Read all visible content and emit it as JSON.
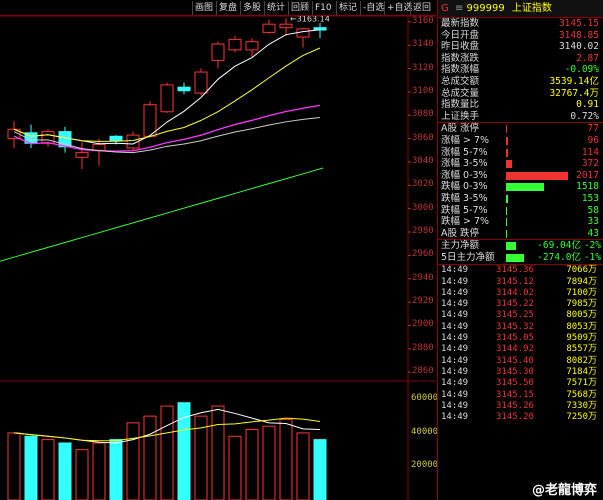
{
  "toolbar": {
    "items": [
      "画图",
      "复盘",
      "多股",
      "统计",
      "回顾",
      "F10",
      "标记",
      "-自选",
      "+自选",
      "返回"
    ]
  },
  "chart": {
    "price_ticks": [
      "3160",
      "3140",
      "3120",
      "3100",
      "3080",
      "3060",
      "3040",
      "3020",
      "3000",
      "2980",
      "2960",
      "2940",
      "2920",
      "2900",
      "2880",
      "2860"
    ],
    "volume_ticks": [
      "60000",
      "40000",
      "20000"
    ],
    "high_label": "3163.14",
    "colors": {
      "up": "#ff3333",
      "down": "#33ffff",
      "ma5": "#ffffff",
      "ma10": "#ffff33",
      "ma20": "#ff33ff",
      "ma30": "#cccccc",
      "ma60": "#33ff33"
    }
  },
  "chart_data": {
    "type": "candlestick",
    "ohlc": [
      {
        "o": 3060,
        "h": 3075,
        "l": 3052,
        "c": 3068
      },
      {
        "o": 3065,
        "h": 3072,
        "l": 3052,
        "c": 3056
      },
      {
        "o": 3056,
        "h": 3068,
        "l": 3053,
        "c": 3066
      },
      {
        "o": 3066,
        "h": 3070,
        "l": 3048,
        "c": 3053
      },
      {
        "o": 3044,
        "h": 3057,
        "l": 3034,
        "c": 3048
      },
      {
        "o": 3050,
        "h": 3060,
        "l": 3037,
        "c": 3055
      },
      {
        "o": 3062,
        "h": 3063,
        "l": 3055,
        "c": 3058
      },
      {
        "o": 3052,
        "h": 3066,
        "l": 3050,
        "c": 3063
      },
      {
        "o": 3062,
        "h": 3092,
        "l": 3061,
        "c": 3089
      },
      {
        "o": 3083,
        "h": 3108,
        "l": 3082,
        "c": 3106
      },
      {
        "o": 3104,
        "h": 3108,
        "l": 3098,
        "c": 3101
      },
      {
        "o": 3099,
        "h": 3120,
        "l": 3097,
        "c": 3117
      },
      {
        "o": 3127,
        "h": 3143,
        "l": 3120,
        "c": 3141
      },
      {
        "o": 3136,
        "h": 3148,
        "l": 3134,
        "c": 3145
      },
      {
        "o": 3136,
        "h": 3146,
        "l": 3130,
        "c": 3143
      },
      {
        "o": 3151,
        "h": 3162,
        "l": 3150,
        "c": 3158
      },
      {
        "o": 3155,
        "h": 3163,
        "l": 3148,
        "c": 3158
      },
      {
        "o": 3147,
        "h": 3155,
        "l": 3138,
        "c": 3154
      },
      {
        "o": 3155,
        "h": 3159,
        "l": 3146,
        "c": 3153
      }
    ],
    "volume": [
      40000,
      38000,
      36000,
      34000,
      30000,
      34000,
      36000,
      46000,
      50000,
      56000,
      58000,
      50000,
      56000,
      38000,
      42000,
      44000,
      48000,
      40000,
      36000
    ]
  },
  "panel": {
    "code": "999999",
    "name": "上证指数",
    "quote": [
      {
        "label": "最新指数",
        "value": "3145.15",
        "color": "#e33"
      },
      {
        "label": "今日开盘",
        "value": "3148.85",
        "color": "#e33"
      },
      {
        "label": "昨日收盘",
        "value": "3140.02",
        "color": "#ddd"
      },
      {
        "label": "指数涨跌",
        "value": "2.87",
        "color": "#e33"
      },
      {
        "label": "指数涨幅",
        "value": "-0.09%",
        "color": "#3f3"
      },
      {
        "label": "总成交额",
        "value": "3539.14亿",
        "color": "#ff0"
      },
      {
        "label": "总成交量",
        "value": "32767.4万",
        "color": "#ff0"
      },
      {
        "label": "指数量比",
        "value": "0.91",
        "color": "#ff0"
      },
      {
        "label": "上证换手",
        "value": "0.72%",
        "color": "#ddd"
      }
    ],
    "breadth": [
      {
        "label": "A股 涨停",
        "value": "77",
        "color": "#e33",
        "bar": 0.02
      },
      {
        "label": "涨幅 > 7%",
        "value": "96",
        "color": "#e33",
        "bar": 0.025
      },
      {
        "label": "涨幅 5-7%",
        "value": "114",
        "color": "#e33",
        "bar": 0.03
      },
      {
        "label": "涨幅 3-5%",
        "value": "372",
        "color": "#e33",
        "bar": 0.1
      },
      {
        "label": "涨幅 0-3%",
        "value": "2017",
        "color": "#e33",
        "bar": 1.0
      },
      {
        "label": "跌幅 0-3%",
        "value": "1518",
        "color": "#3f3",
        "bar": 0.62
      },
      {
        "label": "跌幅 3-5%",
        "value": "153",
        "color": "#3f3",
        "bar": 0.04
      },
      {
        "label": "跌幅 5-7%",
        "value": "58",
        "color": "#3f3",
        "bar": 0.01
      },
      {
        "label": "跌幅 > 7%",
        "value": "33",
        "color": "#3f3",
        "bar": 0.008
      },
      {
        "label": "A股 跌停",
        "value": "43",
        "color": "#3f3",
        "bar": 0.008
      }
    ],
    "flow": [
      {
        "label": "主力净额",
        "value": "-69.04亿",
        "pct": "-2%",
        "bar": 0.1
      },
      {
        "label": "5日主力净额",
        "value": "-274.0亿",
        "pct": "-1%",
        "bar": 0.18
      }
    ],
    "trades": [
      {
        "t": "14:49",
        "p": "3145.36",
        "v": "7066万"
      },
      {
        "t": "14:49",
        "p": "3145.12",
        "v": "7894万"
      },
      {
        "t": "14:49",
        "p": "3144.02",
        "v": "7100万"
      },
      {
        "t": "14:49",
        "p": "3145.22",
        "v": "7985万"
      },
      {
        "t": "14:49",
        "p": "3145.25",
        "v": "8005万"
      },
      {
        "t": "14:49",
        "p": "3145.32",
        "v": "8053万"
      },
      {
        "t": "14:49",
        "p": "3145.05",
        "v": "9509万"
      },
      {
        "t": "14:49",
        "p": "3144.92",
        "v": "8557万"
      },
      {
        "t": "14:49",
        "p": "3145.40",
        "v": "8082万"
      },
      {
        "t": "14:49",
        "p": "3145.30",
        "v": "7184万"
      },
      {
        "t": "14:49",
        "p": "3145.50",
        "v": "7571万"
      },
      {
        "t": "14:49",
        "p": "3145.15",
        "v": "7568万"
      },
      {
        "t": "14:49",
        "p": "3145.26",
        "v": "7330万"
      },
      {
        "t": "14:49",
        "p": "3145.20",
        "v": "7250万"
      }
    ],
    "watermark": "@老龍博弈"
  }
}
